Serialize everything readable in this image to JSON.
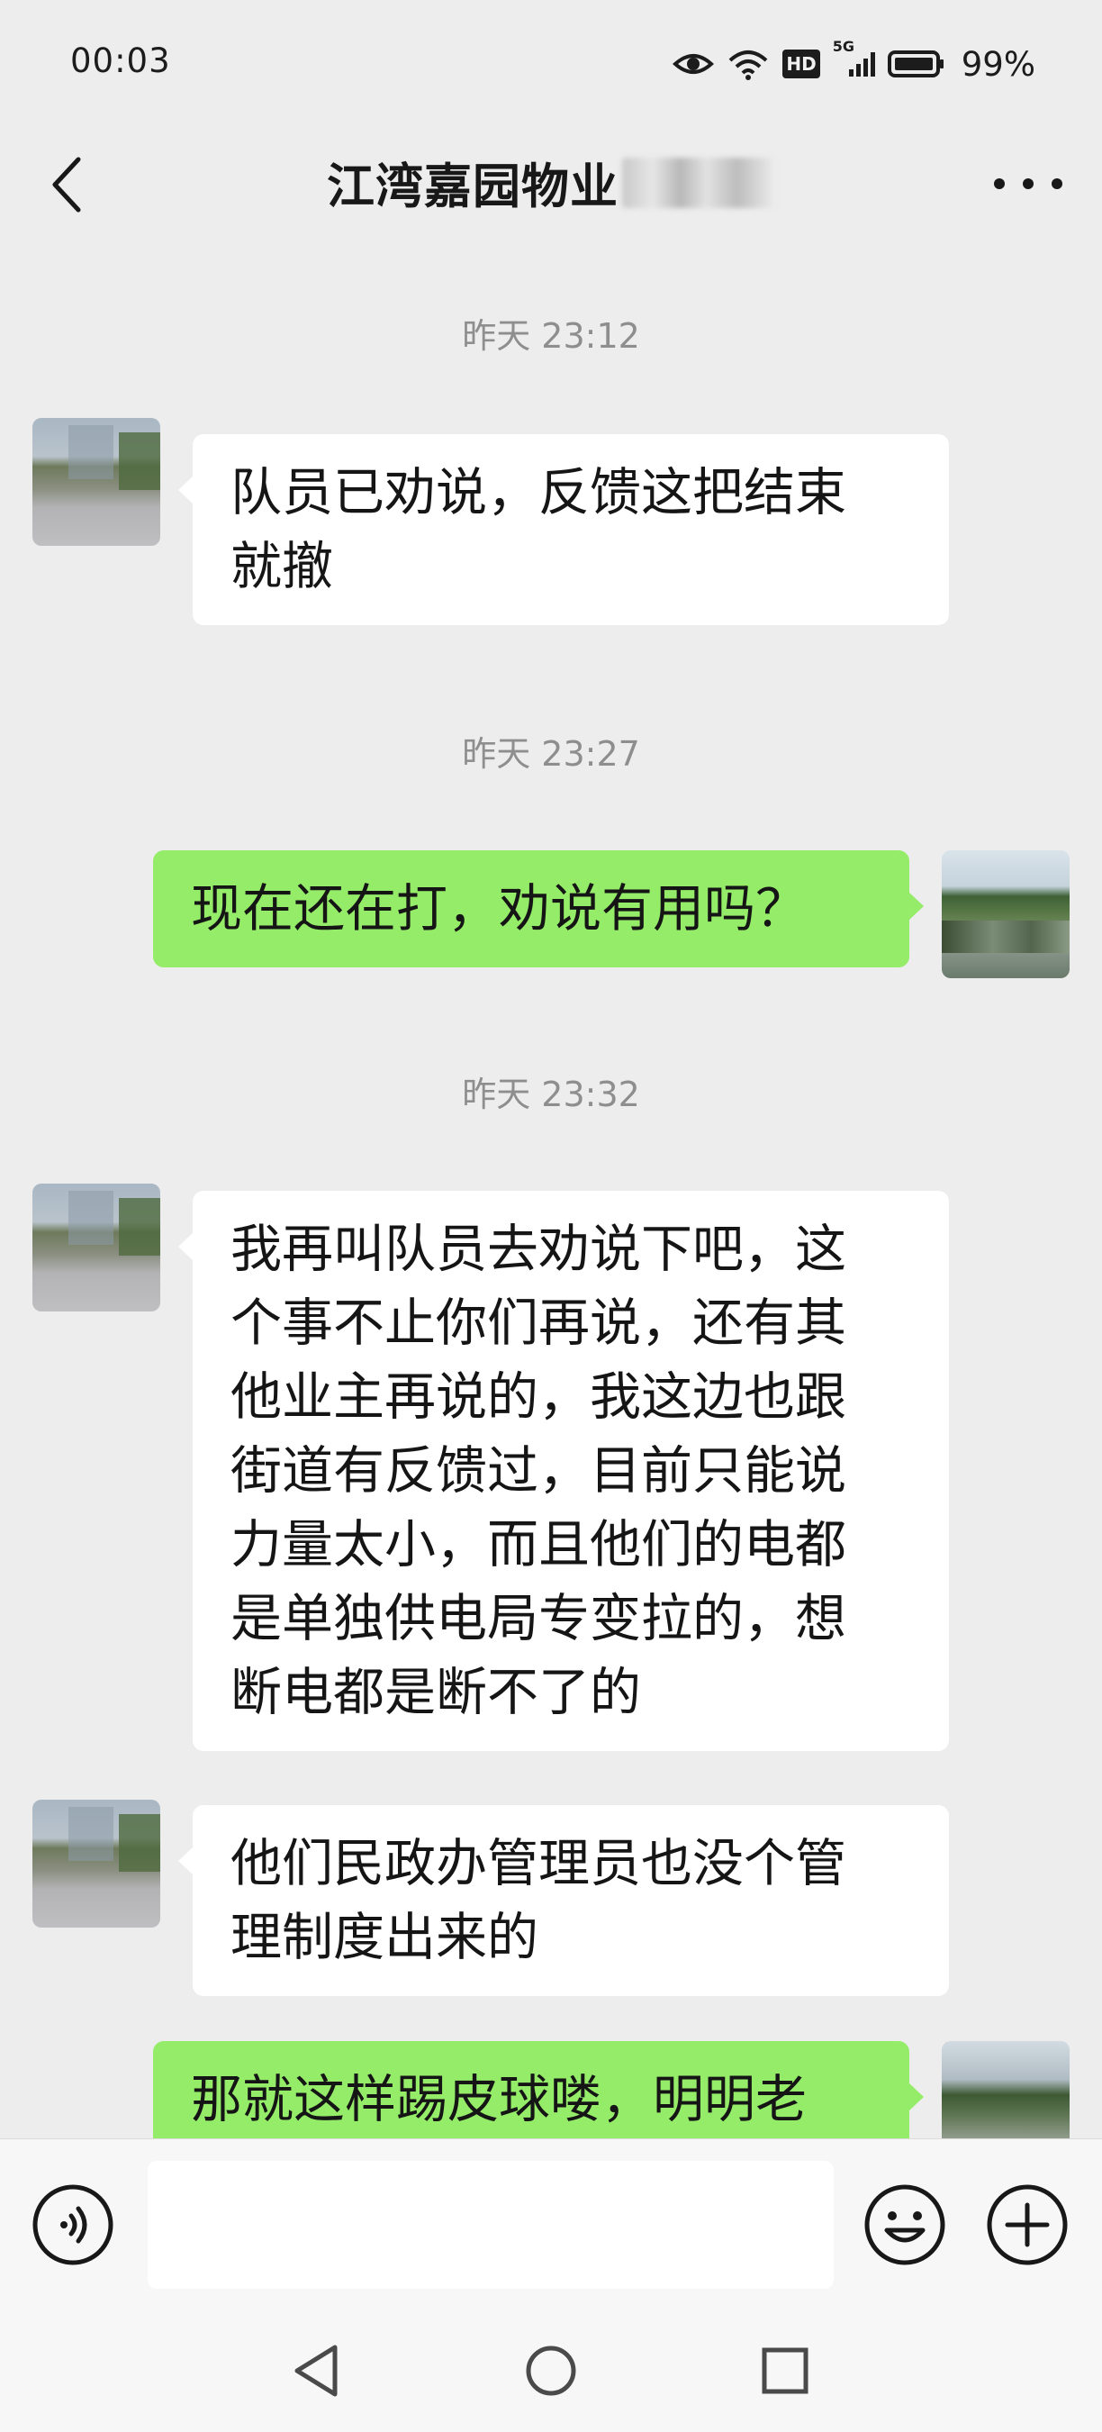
{
  "status_bar": {
    "time": "00:03",
    "signal_label_5g": "5G",
    "hd_label": "HD",
    "battery": "99%"
  },
  "nav": {
    "title": "江湾嘉园物业",
    "back_icon": "chevron-left-icon",
    "more_icon": "ellipsis-icon"
  },
  "messages": [
    {
      "type": "timestamp",
      "text": "昨天 23:12"
    },
    {
      "type": "received",
      "text": "队员已劝说，反馈这把结束\n就撤"
    },
    {
      "type": "timestamp",
      "text": "昨天 23:27"
    },
    {
      "type": "sent",
      "text": "现在还在打，劝说有用吗？"
    },
    {
      "type": "timestamp",
      "text": "昨天 23:32"
    },
    {
      "type": "received",
      "text": "我再叫队员去劝说下吧，这\n个事不止你们再说，还有其\n他业主再说的，我这边也跟\n街道有反馈过，目前只能说\n力量太小，而且他们的电都\n是单独供电局专变拉的，想\n断电都是断不了的"
    },
    {
      "type": "received",
      "text": "他们民政办管理员也没个管\n理制度出来的"
    },
    {
      "type": "sent",
      "text": "那就这样踢皮球喽，明明老"
    }
  ],
  "input_bar": {
    "voice_icon": "voice-icon",
    "emoji_icon": "emoji-icon",
    "plus_icon": "plus-icon",
    "placeholder": ""
  },
  "system_nav": {
    "back_icon": "triangle-back-icon",
    "home_icon": "circle-home-icon",
    "recent_icon": "square-recent-icon"
  },
  "colors": {
    "background": "#ededed",
    "sent_bubble": "#95ec69",
    "received_bubble": "#ffffff",
    "timestamp": "#8e8e8e"
  }
}
